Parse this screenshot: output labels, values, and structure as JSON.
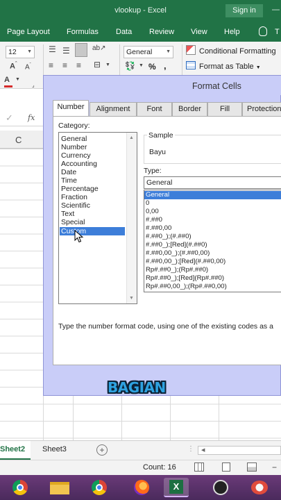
{
  "window": {
    "title": "vlookup  -  Excel",
    "signin_label": "Sign in"
  },
  "ribbon_tabs": [
    "Page Layout",
    "Formulas",
    "Data",
    "Review",
    "View",
    "Help"
  ],
  "ribbon": {
    "font_size": "12",
    "number_format": "General",
    "percent_symbol": "%",
    "comma_symbol": ",",
    "conditional_formatting": "Conditional Formatting",
    "format_as_table": "Format as Table",
    "fx_symbol": "fx",
    "column_c": "C"
  },
  "dialog": {
    "title": "Format Cells",
    "tabs": [
      "Number",
      "Alignment",
      "Font",
      "Border",
      "Fill",
      "Protection"
    ],
    "category_label": "Category:",
    "categories": [
      "General",
      "Number",
      "Currency",
      "Accounting",
      "Date",
      "Time",
      "Percentage",
      "Fraction",
      "Scientific",
      "Text",
      "Special",
      "Custom"
    ],
    "selected_category": "Custom",
    "sample_label": "Sample",
    "sample_value": "Bayu",
    "type_label": "Type:",
    "type_value": "General",
    "formats": [
      "General",
      "0",
      "0,00",
      "#.##0",
      "#.##0,00",
      "#.##0_);(#.##0)",
      "#.##0_);[Red](#.##0)",
      "#.##0,00_);(#.##0,00)",
      "#.##0,00_);[Red](#.##0,00)",
      "Rp#.##0_);(Rp#.##0)",
      "Rp#.##0_);[Red](Rp#.##0)",
      "Rp#.##0,00_);(Rp#.##0,00)"
    ],
    "help_text": "Type the number format code, using one of the existing codes as a"
  },
  "sheets": [
    "Sheet2",
    "Sheet3"
  ],
  "status": {
    "count_text": "Count: 16"
  },
  "overlay_caption": "BAGIAN",
  "colors": {
    "excel_green": "#217346",
    "dialog_frame": "#c9cdf8",
    "selection_blue": "#3d7ed9",
    "caption_blue": "#2ea2e0"
  }
}
